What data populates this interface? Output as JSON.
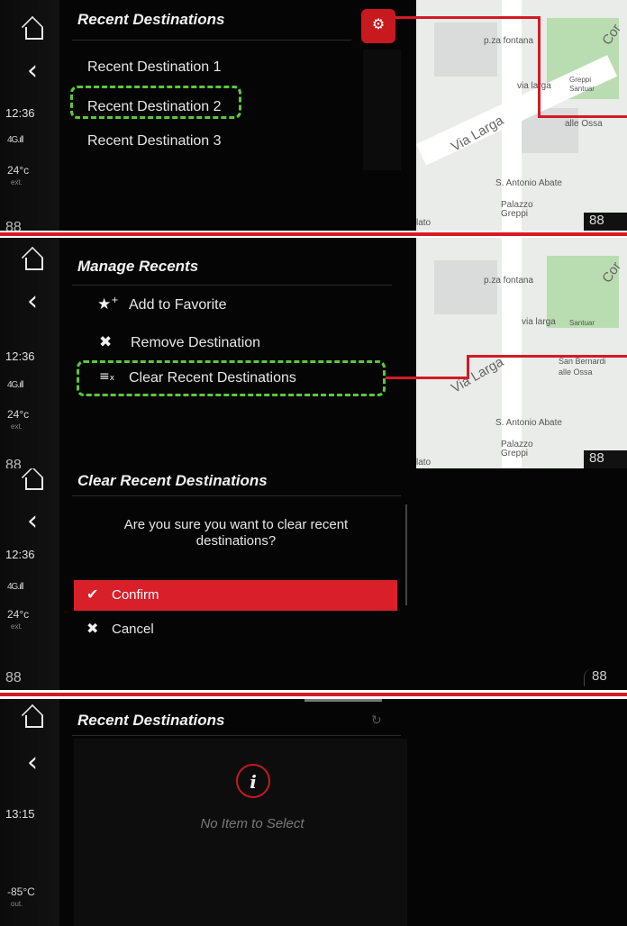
{
  "status": {
    "time_1": "12:36",
    "time_2": "13:15",
    "signal": "4G.ıll",
    "temp_1": "24°c",
    "temp_2": "-85°C",
    "temp_sub_1": "ext.",
    "temp_sub_2": "out.",
    "dial": "88"
  },
  "panel1": {
    "title": "Recent Destinations",
    "items": [
      "Recent Destination 1",
      "Recent Destination 2",
      "Recent Destination 3"
    ]
  },
  "panel2": {
    "title": "Manage Recents",
    "items": [
      "Add to Favorite",
      "Remove Destination",
      "Clear Recent Destinations"
    ]
  },
  "panel3": {
    "title": "Clear Recent Destinations",
    "question": "Are you sure you want to clear recent destinations?",
    "confirm": "Confirm",
    "cancel": "Cancel"
  },
  "panel4": {
    "title": "Recent Destinations",
    "empty_message": "No Item to Select",
    "info_glyph": "i"
  },
  "map": {
    "labels": [
      "p.za fontana",
      "via larga",
      "Via Larga",
      "alle Ossa",
      "S. Antonio Abate",
      "Palazzo",
      "Greppi",
      "Santuar",
      "S. Berna",
      "San Bernardi",
      "Cor",
      "Cor",
      "late",
      "lato"
    ],
    "indicator": "88"
  },
  "colors": {
    "accent_red": "#d41a26",
    "highlight_green": "#5cc83a",
    "background": "#050505"
  },
  "icons": {
    "home": "home-icon",
    "back": "chevron-left-icon",
    "settings": "gear-icon",
    "add_favorite": "star-plus-icon",
    "remove": "close-icon",
    "clear": "clear-list-icon",
    "confirm": "check-icon",
    "cancel": "close-icon",
    "info": "info-icon"
  }
}
